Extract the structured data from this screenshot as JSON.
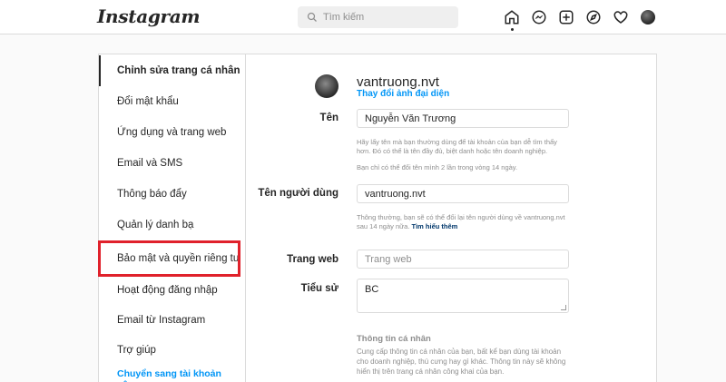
{
  "topnav": {
    "logo": "Instagram",
    "search_placeholder": "Tìm kiếm",
    "icons": [
      "home-icon",
      "messenger-icon",
      "new-post-icon",
      "explore-icon",
      "heart-icon",
      "avatar"
    ]
  },
  "sidebar": {
    "items": [
      {
        "label": "Chỉnh sửa trang cá nhân",
        "active": true
      },
      {
        "label": "Đổi mật khẩu"
      },
      {
        "label": "Ứng dụng và trang web"
      },
      {
        "label": "Email và SMS"
      },
      {
        "label": "Thông báo đẩy"
      },
      {
        "label": "Quản lý danh bạ"
      },
      {
        "label": "Bảo mật và quyền riêng tư",
        "highlighted": true
      },
      {
        "label": "Hoạt động đăng nhập"
      },
      {
        "label": "Email từ Instagram"
      },
      {
        "label": "Trợ giúp"
      },
      {
        "label": "Chuyển sang tài khoản công",
        "link": true
      }
    ]
  },
  "profile": {
    "username": "vantruong.nvt",
    "change_photo": "Thay đổi ảnh đại diện"
  },
  "form": {
    "name_label": "Tên",
    "name_value": "Nguyễn Văn Trương",
    "name_help_1": "Hãy lấy tên mà bạn thường dùng để tài khoản của bạn dễ tìm thấy hơn. Đó có thể là tên đầy đủ, biệt danh hoặc tên doanh nghiệp.",
    "name_help_2": "Bạn chỉ có thể đổi tên mình 2 lần trong vòng 14 ngày.",
    "username_label": "Tên người dùng",
    "username_value": "vantruong.nvt",
    "username_help": "Thông thường, bạn sẽ có thể đổi lại tên người dùng về vantruong.nvt sau 14 ngày nữa.",
    "username_help_link": "Tìm hiểu thêm",
    "website_label": "Trang web",
    "website_placeholder": "Trang web",
    "bio_label": "Tiểu sử",
    "bio_value": "BC",
    "personal_info_title": "Thông tin cá nhân",
    "personal_info_help": "Cung cấp thông tin cá nhân của bạn, bất kể bạn dùng tài khoản cho doanh nghiệp, thú cưng hay gì khác. Thông tin này sẽ không hiển thị trên trang cá nhân công khai của bạn."
  },
  "colors": {
    "accent": "#0095f6",
    "highlight_box": "#e0212b"
  }
}
